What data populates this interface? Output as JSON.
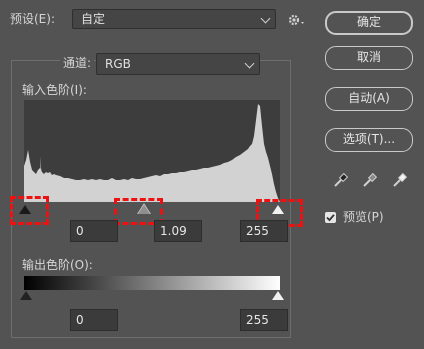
{
  "preset": {
    "label": "预设(E):",
    "value": "自定"
  },
  "channel": {
    "label": "通道:",
    "value": "RGB"
  },
  "input_levels": {
    "label": "输入色阶(I):",
    "black": "0",
    "mid": "1.09",
    "white": "255"
  },
  "output_levels": {
    "label": "输出色阶(O):",
    "black": "0",
    "white": "255"
  },
  "buttons": {
    "ok": "确定",
    "cancel": "取消",
    "auto": "自动(A)",
    "options": "选项(T)..."
  },
  "preview": {
    "label": "预览(P)",
    "checked": true
  },
  "icons": {
    "settings": "gear-icon",
    "eyedroppers": [
      "black-eyedropper-icon",
      "gray-eyedropper-icon",
      "white-eyedropper-icon"
    ]
  },
  "colors": {
    "highlight": "#ee1111",
    "histogram": "#d2d2d2"
  }
}
